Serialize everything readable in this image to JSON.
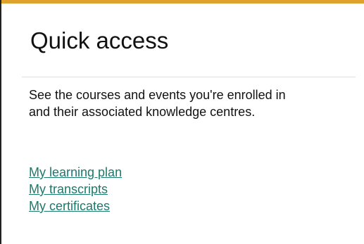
{
  "colors": {
    "accent_bar": "#e0a22f",
    "link": "#1a7a6e",
    "text": "#111111"
  },
  "quick_access": {
    "title": "Quick access",
    "description": "See the courses and events you're enrolled in and their associated knowledge centres.",
    "links": [
      {
        "label": "My learning plan"
      },
      {
        "label": "My transcripts"
      },
      {
        "label": "My certificates"
      }
    ]
  }
}
